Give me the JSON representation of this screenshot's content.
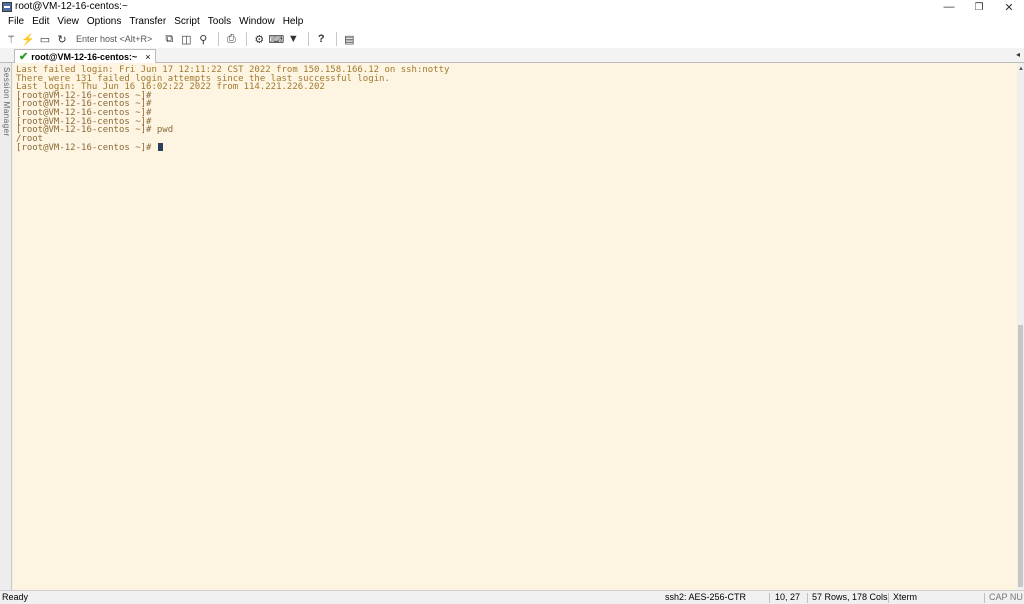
{
  "window": {
    "title": "root@VM-12-16-centos:~",
    "minimize_glyph": "—",
    "maximize_glyph": "❐",
    "close_glyph": "✕"
  },
  "menu": [
    "File",
    "Edit",
    "View",
    "Options",
    "Transfer",
    "Script",
    "Tools",
    "Window",
    "Help"
  ],
  "toolbar": {
    "host_placeholder": "Enter host <Alt+R>"
  },
  "tab": {
    "label": "root@VM-12-16-centos:~",
    "close_glyph": "×",
    "check_glyph": "✔",
    "scroll_glyph": "◂"
  },
  "session_manager": {
    "label": "Session Manager"
  },
  "terminal": {
    "lines": [
      "Last failed login: Fri Jun 17 12:11:22 CST 2022 from 150.158.166.12 on ssh:notty",
      "There were 131 failed login attempts since the last successful login.",
      "Last login: Thu Jun 16 16:02:22 2022 from 114.221.226.202",
      "[root@VM-12-16-centos ~]#",
      "[root@VM-12-16-centos ~]#",
      "[root@VM-12-16-centos ~]#",
      "[root@VM-12-16-centos ~]#",
      "[root@VM-12-16-centos ~]# pwd",
      "/root"
    ],
    "prompt": "[root@VM-12-16-centos ~]# "
  },
  "status": {
    "ready": "Ready",
    "cipher": "ssh2: AES-256-CTR",
    "cursor_pos": "10, 27",
    "size": "57 Rows, 178 Cols",
    "term_type": "Xterm",
    "caps": "CAP NU"
  },
  "colors": {
    "terminal_bg": "#fdf5e2",
    "terminal_fg": "#a07830",
    "cursor": "#2c3e58",
    "connected_check": "#2a9a2a"
  }
}
